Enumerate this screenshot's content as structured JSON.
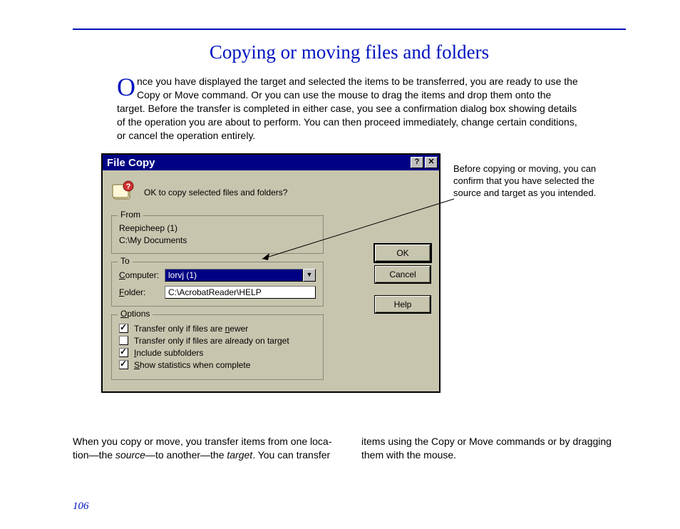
{
  "page": {
    "title": "Copying or moving files and folders",
    "dropcap": "O",
    "intro_rest": "nce you have displayed the target and selected the items to be transferred, you are ready to use the Copy or Move command. Or you can use the mouse to drag the items and drop them onto the target. Before the transfer is completed in either case, you see a confirmation dialog box showing details of the operation you are about to perform. You can then proceed immediately, change certain conditions, or cancel the operation entirely.",
    "callout": "Before copying or moving, you can confirm that you have selected the source and target as you intended.",
    "col_left_a": "When you copy or move, you transfer items from one loca­tion—the ",
    "col_left_b": "source",
    "col_left_c": "—to another—the ",
    "col_left_d": "target",
    "col_left_e": ". You can transfer ",
    "col_right": "items using the Copy or Move commands or by dragging them with the mouse.",
    "page_number": "106"
  },
  "dialog": {
    "title": "File Copy",
    "help_btn": "?",
    "close_btn": "✕",
    "prompt": "OK to copy selected files and folders?",
    "from": {
      "legend": "From",
      "line1": "Reepicheep (1)",
      "line2": "C:\\My Documents"
    },
    "to": {
      "legend": "To",
      "computer_label_pre": "C",
      "computer_label_post": "omputer:",
      "computer_value": "lorvj (1)",
      "folder_label_pre": "F",
      "folder_label_post": "older:",
      "folder_value": "C:\\AcrobatReader\\HELP"
    },
    "options": {
      "legend_pre": "O",
      "legend_post": "ptions",
      "opt1_pre": "Transfer only if files are ",
      "opt1_u": "n",
      "opt1_post": "ewer",
      "opt1_checked": true,
      "opt2_pre": "Transfer only if files are already on tar",
      "opt2_u": "g",
      "opt2_post": "et",
      "opt2_checked": false,
      "opt3_pre": "I",
      "opt3_post": "nclude subfolders",
      "opt3_checked": true,
      "opt4_pre": "S",
      "opt4_post": "how statistics when complete",
      "opt4_checked": true
    },
    "buttons": {
      "ok": "OK",
      "cancel": "Cancel",
      "help": "Help"
    }
  }
}
